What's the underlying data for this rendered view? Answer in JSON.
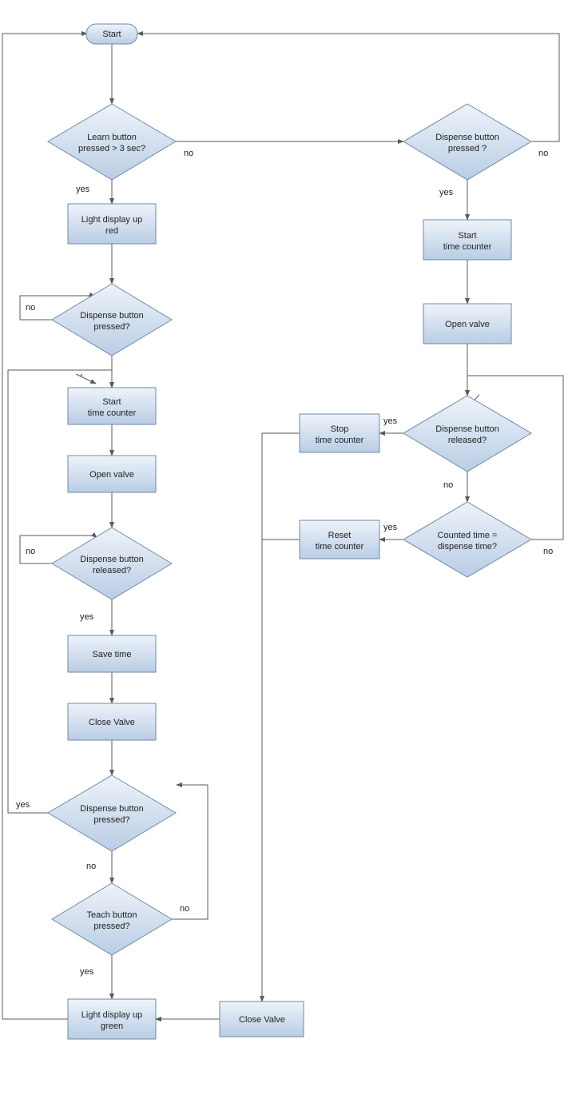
{
  "start": "Start",
  "learn_decision": {
    "l1": "Learn button",
    "l2": "pressed > 3 sec?"
  },
  "dispense_decision_r": {
    "l1": "Dispense button",
    "l2": "pressed ?"
  },
  "light_red": {
    "l1": "Light display up",
    "l2": "red"
  },
  "start_counter_r": {
    "l1": "Start",
    "l2": "time counter"
  },
  "dispense_pressed_l": {
    "l1": "Dispense button",
    "l2": "pressed?"
  },
  "open_valve_r": "Open valve",
  "start_counter_l": {
    "l1": "Start",
    "l2": "time counter"
  },
  "open_valve_l": "Open valve",
  "released_r": {
    "l1": "Dispense button",
    "l2": "released?"
  },
  "stop_counter": {
    "l1": "Stop",
    "l2": "time counter"
  },
  "counted_eq": {
    "l1": "Counted time =",
    "l2": "dispense time?"
  },
  "reset_counter": {
    "l1": "Reset",
    "l2": "time counter"
  },
  "released_l": {
    "l1": "Dispense button",
    "l2": "released?"
  },
  "save_time": "Save time",
  "close_valve_l": "Close Valve",
  "dispense_pressed2": {
    "l1": "Dispense button",
    "l2": "pressed?"
  },
  "teach_pressed": {
    "l1": "Teach button",
    "l2": "pressed?"
  },
  "light_green": {
    "l1": "Light display up",
    "l2": "green"
  },
  "close_valve_r": "Close Valve",
  "labels": {
    "yes": "yes",
    "no": "no"
  }
}
